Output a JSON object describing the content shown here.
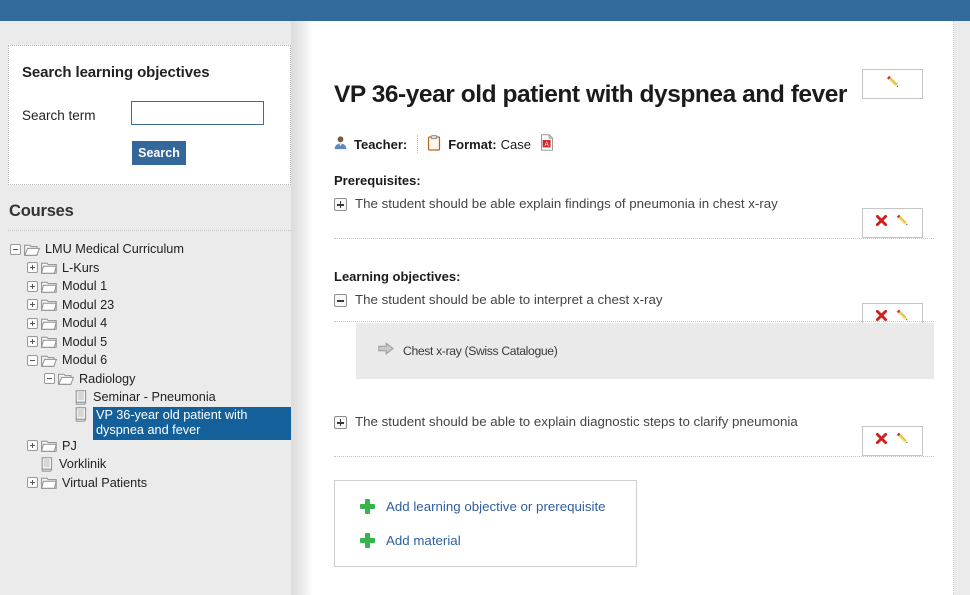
{
  "topbar": {
    "color": "#336a9c"
  },
  "sidebar": {
    "search": {
      "title": "Search learning objectives",
      "label": "Search term",
      "value": "",
      "placeholder": "",
      "button": "Search"
    },
    "courses_title": "Courses",
    "tree": [
      {
        "label": "LMU Medical Curriculum",
        "depth": 0,
        "icon": "folder-open-icon",
        "toggle": "minus",
        "selected": false
      },
      {
        "label": "L-Kurs",
        "depth": 1,
        "icon": "folder-icon",
        "toggle": "plus",
        "selected": false
      },
      {
        "label": "Modul 1",
        "depth": 1,
        "icon": "folder-icon",
        "toggle": "plus",
        "selected": false
      },
      {
        "label": "Modul 23",
        "depth": 1,
        "icon": "folder-icon",
        "toggle": "plus",
        "selected": false
      },
      {
        "label": "Modul 4",
        "depth": 1,
        "icon": "folder-icon",
        "toggle": "plus",
        "selected": false
      },
      {
        "label": "Modul 5",
        "depth": 1,
        "icon": "folder-icon",
        "toggle": "plus",
        "selected": false
      },
      {
        "label": "Modul 6",
        "depth": 1,
        "icon": "folder-open-icon",
        "toggle": "minus",
        "selected": false
      },
      {
        "label": "Radiology",
        "depth": 2,
        "icon": "folder-open-icon",
        "toggle": "minus",
        "selected": false
      },
      {
        "label": "Seminar - Pneumonia",
        "depth": 3,
        "icon": "document-icon",
        "toggle": "none",
        "selected": false
      },
      {
        "label": "VP 36-year old patient with dyspnea and fever",
        "depth": 3,
        "icon": "document-icon",
        "toggle": "none",
        "selected": true
      },
      {
        "label": "PJ",
        "depth": 1,
        "icon": "folder-icon",
        "toggle": "plus",
        "selected": false
      },
      {
        "label": "Vorklinik",
        "depth": 1,
        "icon": "document-icon",
        "toggle": "none",
        "selected": false
      },
      {
        "label": "Virtual Patients",
        "depth": 1,
        "icon": "folder-icon",
        "toggle": "plus",
        "selected": false
      }
    ],
    "selected_color": "#14609b"
  },
  "main": {
    "page_title": "VP 36-year old patient with dyspnea and fever",
    "meta": {
      "teacher_label": "Teacher:",
      "teacher_value": "",
      "format_label": "Format:",
      "format_value": "Case"
    },
    "prerequisites_label": "Prerequisites:",
    "prerequisites": [
      {
        "text": "The student should be able explain findings of pneumonia in chest x-ray",
        "toggle": "plus"
      }
    ],
    "learning_objectives_label": "Learning objectives:",
    "learning_objectives": [
      {
        "text": "The student should be able to interpret a chest x-ray",
        "toggle": "minus",
        "materials": [
          {
            "text": "Chest x-ray (Swiss Catalogue)"
          }
        ]
      },
      {
        "text": "The student should be able to explain diagnostic steps to clarify pneumonia",
        "toggle": "plus",
        "materials": []
      }
    ],
    "add_actions": [
      {
        "label": "Add learning objective or prerequisite"
      },
      {
        "label": "Add material"
      }
    ],
    "accent_link_color": "#2f5f9e",
    "add_icon_color": "#36b54a",
    "delete_icon_color": "#d02020"
  }
}
